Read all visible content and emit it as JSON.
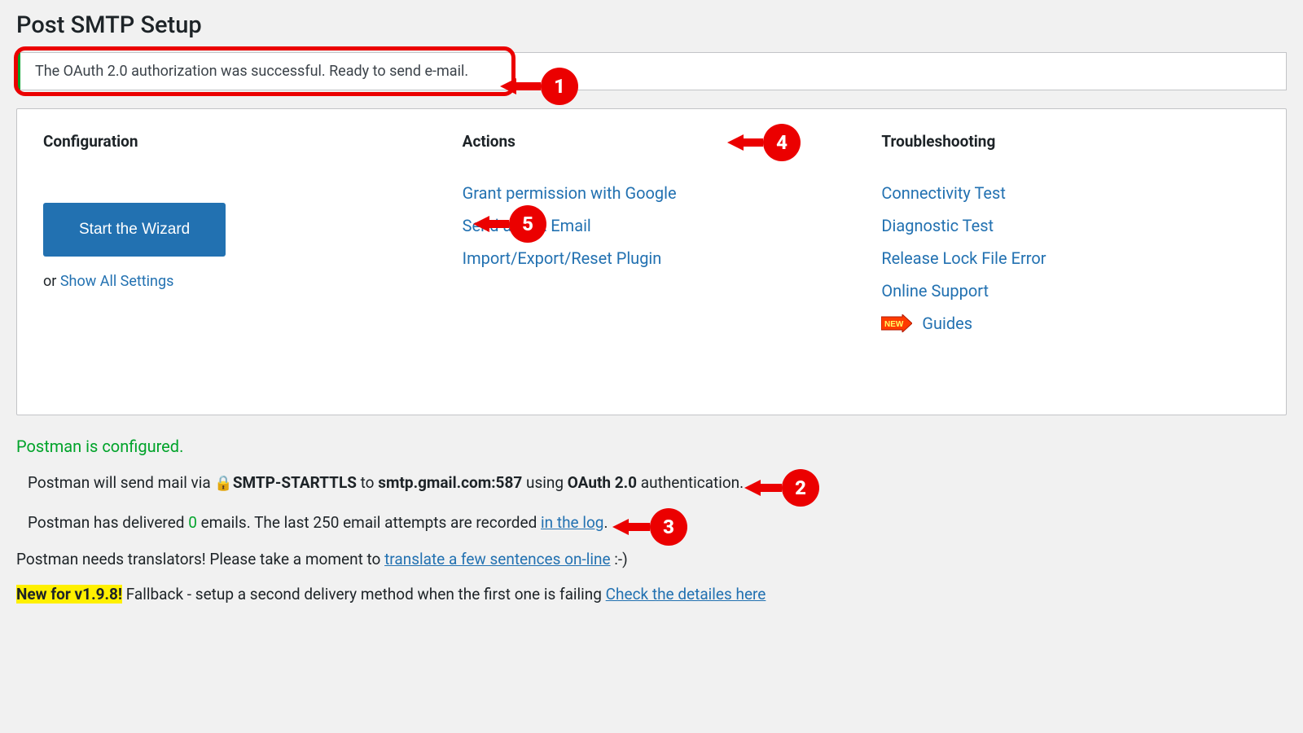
{
  "page_title": "Post SMTP Setup",
  "notice": {
    "message": "The OAuth 2.0 authorization was successful. Ready to send e-mail."
  },
  "columns": {
    "configuration": {
      "title": "Configuration",
      "wizard_button": "Start the Wizard",
      "or_text": "or ",
      "show_all": "Show All Settings"
    },
    "actions": {
      "title": "Actions",
      "links": {
        "grant": "Grant permission with Google",
        "test_email": "Send a Test Email",
        "import_export": "Import/Export/Reset Plugin"
      }
    },
    "troubleshooting": {
      "title": "Troubleshooting",
      "links": {
        "connectivity": "Connectivity Test",
        "diagnostic": "Diagnostic Test",
        "release_lock": "Release Lock File Error",
        "support": "Online Support",
        "guides": "Guides"
      },
      "new_badge_text": "NEW"
    }
  },
  "status": {
    "configured": "Postman is configured.",
    "send_line": {
      "prefix": "Postman will send mail via ",
      "lock_icon": "🔒",
      "protocol": "SMTP-STARTTLS",
      "to_text": " to ",
      "host": "smtp.gmail.com:587",
      "using_text": " using ",
      "auth": "OAuth 2.0",
      "suffix": " authentication."
    },
    "delivered_line": {
      "prefix": "Postman has delivered ",
      "count": "0",
      "mid": " emails. The last 250 email attempts are recorded ",
      "log_link": "in the log",
      "suffix": "."
    }
  },
  "footer": {
    "translators": {
      "prefix": "Postman needs translators! Please take a moment to ",
      "link": "translate a few sentences on-line",
      "suffix": " :-)"
    },
    "new_version": {
      "highlight": "New for v1.9.8!",
      "text": " Fallback - setup a second delivery method when the first one is failing ",
      "link": "Check the detailes here"
    }
  },
  "annotations": {
    "a1": "1",
    "a2": "2",
    "a3": "3",
    "a4": "4",
    "a5": "5"
  }
}
